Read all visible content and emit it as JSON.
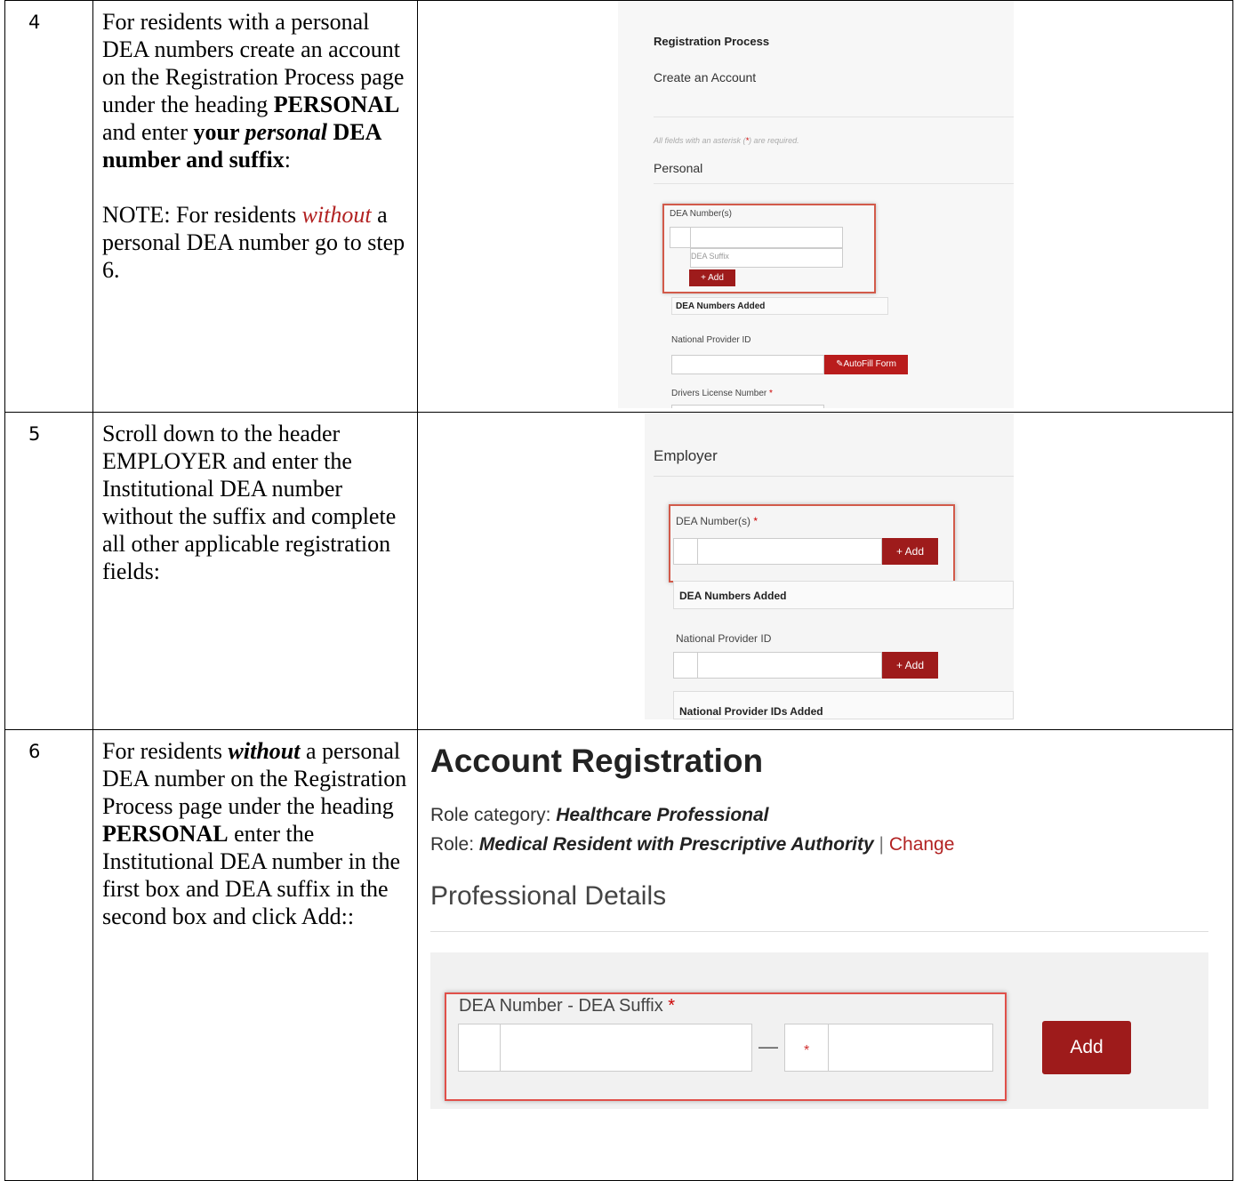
{
  "rows": [
    {
      "num": "4",
      "text_p1": [
        "For residents with a personal DEA numbers create an account on the Registration Process page under the heading ",
        "PERSONAL",
        " and enter ",
        "your ",
        "personal",
        " DEA number and suffix",
        ":"
      ],
      "text_p2": [
        "NOTE: For residents ",
        "without",
        " a personal DEA number go to step 6."
      ],
      "screenshot": {
        "heading": "Registration Process",
        "subheading": "Create an Account",
        "required_note_pre": "All fields with an asterisk (",
        "required_note_ast": "*",
        "required_note_post": ") are required.",
        "section": "Personal",
        "dea_label": "DEA Number(s)",
        "suffix_placeholder": "DEA Suffix",
        "add_label": "+ Add",
        "dea_added": "DEA Numbers Added",
        "npi_label": "National Provider ID",
        "autofill_label": "✎AutoFill Form",
        "drivers_license_label": "Drivers License Number",
        "required_mark": "*"
      }
    },
    {
      "num": "5",
      "text": "Scroll down to the header EMPLOYER and enter the Institutional DEA number without the suffix and complete all other applicable registration fields:",
      "screenshot": {
        "section": "Employer",
        "dea_label": "DEA Number(s)",
        "required_mark": "*",
        "add_label": "+ Add",
        "dea_added": "DEA Numbers Added",
        "npi_label": "National Provider ID",
        "npi_add_label": "+ Add",
        "npi_added": "National Provider IDs Added"
      }
    },
    {
      "num": "6",
      "text": [
        "For residents ",
        "without",
        " a personal DEA number on the Registration Process page under the heading ",
        "PERSONAL",
        " enter the Institutional DEA number in the first box and DEA suffix in the second box and click Add::"
      ],
      "screenshot": {
        "title": "Account Registration",
        "role_category_label": "Role category: ",
        "role_category_value": "Healthcare Professional",
        "role_label": "Role: ",
        "role_value": "Medical Resident with Prescriptive Authority",
        "separator": "|",
        "change_link": "Change",
        "section": "Professional Details",
        "dea_label": "DEA Number - DEA Suffix",
        "required_mark": "*",
        "dash": "—",
        "inner_required_mark": "*",
        "add_label": "Add"
      }
    }
  ],
  "colors": {
    "button_red": "#9e1b1b",
    "highlight_border": "#d25a4a",
    "link_red": "#b22222"
  }
}
